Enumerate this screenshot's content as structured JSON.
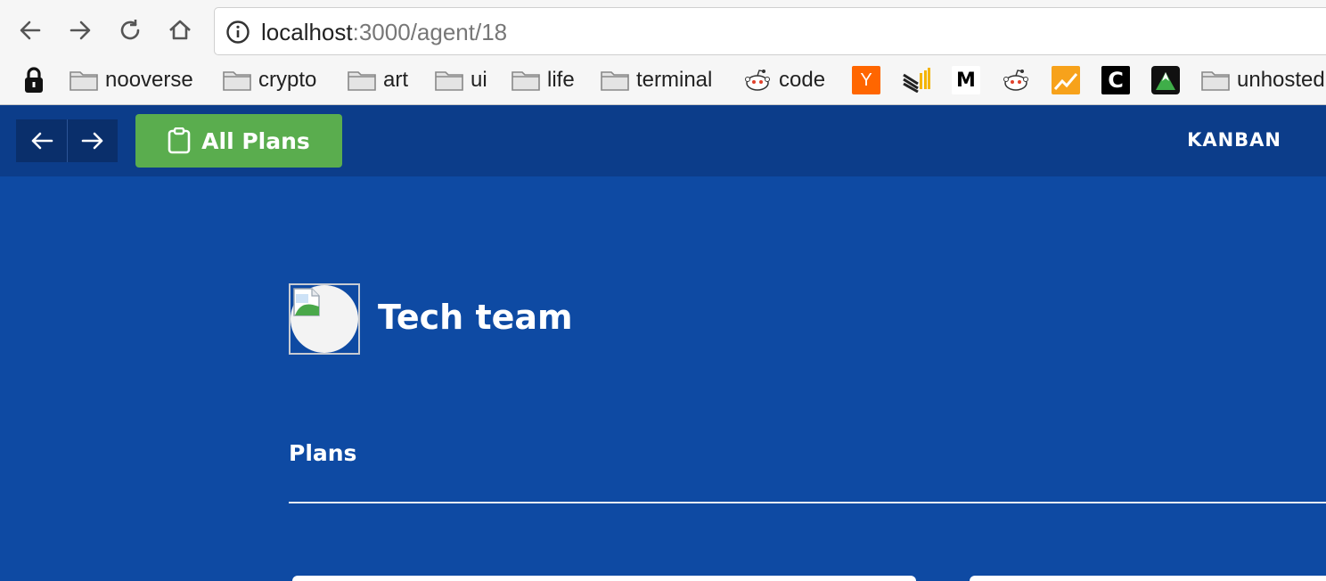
{
  "browser": {
    "url_host": "localhost",
    "url_path": ":3000/agent/18",
    "bookmarks": [
      {
        "type": "folder",
        "label": "nooverse"
      },
      {
        "type": "folder",
        "label": "crypto"
      },
      {
        "type": "folder",
        "label": "art"
      },
      {
        "type": "folder",
        "label": "ui"
      },
      {
        "type": "folder",
        "label": "life"
      },
      {
        "type": "folder",
        "label": "terminal"
      },
      {
        "type": "site",
        "label": "code",
        "icon": "reddit-icon"
      },
      {
        "type": "site",
        "label": "",
        "icon": "hacker-news-icon",
        "text": "Y"
      },
      {
        "type": "site",
        "label": "",
        "icon": "bars-logo-icon"
      },
      {
        "type": "site",
        "label": "",
        "icon": "medium-icon",
        "text": "M"
      },
      {
        "type": "site",
        "label": "",
        "icon": "reddit-icon"
      },
      {
        "type": "site",
        "label": "",
        "icon": "chart-icon"
      },
      {
        "type": "site",
        "label": "",
        "icon": "c-logo-icon",
        "text": "C"
      },
      {
        "type": "site",
        "label": "",
        "icon": "mountain-icon"
      },
      {
        "type": "folder",
        "label": "unhosted"
      }
    ]
  },
  "header": {
    "all_plans_label": "All Plans",
    "kanban_label": "KANBAN"
  },
  "main": {
    "team_name": "Tech team",
    "section_title": "Plans"
  },
  "colors": {
    "background": "#0e4aa3",
    "header": "#0c3d8a",
    "accent_green": "#5aad4e"
  }
}
